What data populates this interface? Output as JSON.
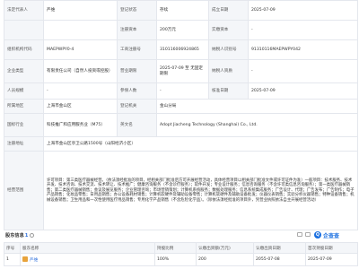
{
  "info": {
    "legal_rep_label": "法定代表人",
    "legal_rep_value": "严维",
    "op_status_label": "登记状态",
    "op_status_value": "存续",
    "established_label": "成立日期",
    "established_value": "2025-07-09",
    "reg_capital_label": "注册资本",
    "reg_capital_value": "200万元",
    "paid_capital_label": "实缴资本",
    "paid_capital_value": "-",
    "org_code_label": "组织机构代码",
    "org_code_value": "MAEPWPY0-4",
    "biz_reg_label": "工商注册号",
    "biz_reg_value": "310116006924865",
    "tax_id_label": "纳税人识别号",
    "tax_id_value": "91310116MAEPWPY042",
    "company_type_label": "企业类型",
    "company_type_value": "有限责任公司（自然人投资或控股）",
    "term_label": "营业期限",
    "term_value": "2025-07-09 至 无固定期限",
    "taxpayer_q_label": "纳税人资质",
    "taxpayer_q_value": "-",
    "staff_label": "人员规模",
    "staff_value": "-",
    "insured_label": "参保人数",
    "insured_value": "-",
    "approval_label": "核准日期",
    "approval_value": "2025-07-09",
    "region_label": "所属地区",
    "region_value": "上海市金山区",
    "authority_label": "登记机关",
    "authority_value": "金山分局",
    "industry_label": "国标行业",
    "industry_value": "科技推广和应用服务业（M75）",
    "english_label": "英文名",
    "english_value": "Adopt Jiacheng Technology (Shanghai) Co., Ltd.",
    "address_label": "注册地址",
    "address_value": "上海市金山区亭卫公路1500号（山阳经济小区）",
    "scope_label": "经营范围",
    "scope_value": "许可项目：第三类医疗器械经营。（依法须经批准的项目，经相关部门批准后方可开展经营活动，具体经营项目以相关部门批准文件或许可证件为准）一般项目：技术服务、技术开发、技术咨询、技术交流、技术转让、技术推广；健康咨询服务（不含诊疗服务）；软件开发；专业设计服务；信息咨询服务（不含许可类信息咨询服务）；第一类医疗器械销售；第二类医疗器械销售；会议及展览服务；企业管理咨询；市场营销策划；计算机系统服务；数据处理服务；信息系统集成服务；广告设计、代理；广告发布；广告制作；电子产品销售；化妆品零售；日用品销售；办公设备耗材销售；计算机软硬件及辅助设备零售；计算机软硬件及辅助设备批发；仪器仪表销售；实验分析仪器销售；特种设备销售；机械设备销售；卫生用品和一次性使用医疗用品销售；专用化学产品销售（不含危险化学品）。（除依法须经批准的项目外，凭营业执照依法自主开展经营活动）"
  },
  "shareholders": {
    "title": "股东信息",
    "count": "1",
    "brand": "企查查",
    "brand_logo_char": "Q",
    "columns": [
      "序号",
      "股东名称",
      "持股比例",
      "认缴出资额(万元)",
      "认缴出资日期",
      "首次持股日期"
    ],
    "rows": [
      {
        "index": "1",
        "name": "严维",
        "ratio": "100%",
        "amount": "200",
        "subscribe_date": "2055-07-08",
        "first_date": "2025-07-09"
      }
    ]
  }
}
